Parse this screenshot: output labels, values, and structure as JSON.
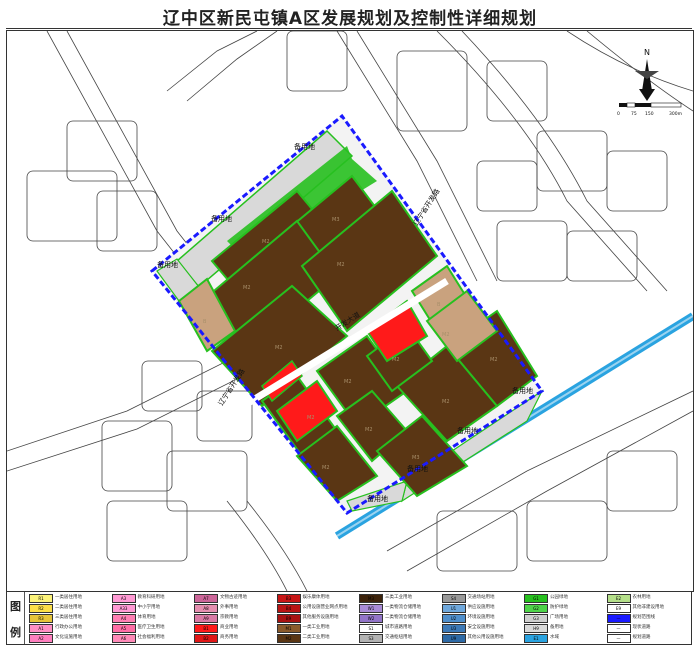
{
  "title": "辽中区新民屯镇A区发展规划及控制性详细规划",
  "legend_heading": [
    "图",
    "例"
  ],
  "map": {
    "reserve_label": "备用地",
    "road_main": "开发大道",
    "road_ne": "辽宁省开发路",
    "road_sw": "辽宁省开发路",
    "block_codes": [
      "M2",
      "M3",
      "M2",
      "M2",
      "M2",
      "M2",
      "B",
      "B",
      "M2",
      "M2",
      "M2",
      "M3",
      "M2",
      "M2",
      "M2",
      "M2"
    ],
    "scale_labels": [
      "0",
      "75",
      "150",
      "300m"
    ],
    "north_label": "N",
    "colors": {
      "industrial": "#5a3614",
      "commercial_red": "#ff1a1a",
      "residential_tan": "#c9a27e",
      "reserve_grey": "#d9d9d9",
      "green": "#27c01f",
      "boundary_blue": "#1a1aff",
      "river": "#2aa3e0",
      "road_line": "#444444"
    }
  },
  "legend": [
    {
      "code": "R1",
      "label": "一类居住用地",
      "color": "#fcf37a"
    },
    {
      "code": "R2",
      "label": "二类居住用地",
      "color": "#fcdf48"
    },
    {
      "code": "R3",
      "label": "三类居住用地",
      "color": "#e6c53a"
    },
    {
      "code": "A1",
      "label": "行政办公用地",
      "color": "#ff8fc4"
    },
    {
      "code": "A2",
      "label": "文化设施用地",
      "color": "#ff7fbf"
    },
    {
      "code": "A3",
      "label": "教育科研用地",
      "color": "#ff9ad4"
    },
    {
      "code": "A33",
      "label": "中小学用地",
      "color": "#ff9ad4"
    },
    {
      "code": "A4",
      "label": "体育用地",
      "color": "#ff80b4"
    },
    {
      "code": "A5",
      "label": "医疗卫生用地",
      "color": "#ff6ea6"
    },
    {
      "code": "A6",
      "label": "社会福利用地",
      "color": "#ff8ab8"
    },
    {
      "code": "A7",
      "label": "文物古迹用地",
      "color": "#cc6699"
    },
    {
      "code": "A8",
      "label": "外事用地",
      "color": "#e58fb0"
    },
    {
      "code": "A9",
      "label": "宗教用地",
      "color": "#d97aa5"
    },
    {
      "code": "B1",
      "label": "商业用地",
      "color": "#ff1a1a"
    },
    {
      "code": "B2",
      "label": "商务用地",
      "color": "#e01717"
    },
    {
      "code": "B3",
      "label": "娱乐康体用地",
      "color": "#c81616"
    },
    {
      "code": "B4",
      "label": "公用设施营业网点用地",
      "color": "#b91414"
    },
    {
      "code": "B9",
      "label": "其他服务设施用地",
      "color": "#a81212"
    },
    {
      "code": "M1",
      "label": "一类工业用地",
      "color": "#8a5a2b"
    },
    {
      "code": "M2",
      "label": "二类工业用地",
      "color": "#5a3614"
    },
    {
      "code": "M3",
      "label": "三类工业用地",
      "color": "#3d230b"
    },
    {
      "code": "W1",
      "label": "一类物流仓储用地",
      "color": "#a98bd6"
    },
    {
      "code": "W2",
      "label": "二类物流仓储用地",
      "color": "#9375c9"
    },
    {
      "code": "S1",
      "label": "城市道路用地",
      "color": "#ffffff"
    },
    {
      "code": "S3",
      "label": "交通枢纽用地",
      "color": "#b3b3b3"
    },
    {
      "code": "S4",
      "label": "交通场站用地",
      "color": "#999999"
    },
    {
      "code": "U1",
      "label": "供应设施用地",
      "color": "#6fa8dc"
    },
    {
      "code": "U2",
      "label": "环境设施用地",
      "color": "#4f8fcc"
    },
    {
      "code": "U3",
      "label": "安全设施用地",
      "color": "#3d7ab8"
    },
    {
      "code": "U9",
      "label": "其他公用设施用地",
      "color": "#2e6aa6"
    },
    {
      "code": "G1",
      "label": "公园绿地",
      "color": "#27c01f"
    },
    {
      "code": "G2",
      "label": "防护绿地",
      "color": "#4fd44a"
    },
    {
      "code": "G3",
      "label": "广场用地",
      "color": "#cfcfcf"
    },
    {
      "code": "H9",
      "label": "备用地",
      "color": "#d9d9d9"
    },
    {
      "code": "E1",
      "label": "水域",
      "color": "#2aa3e0"
    },
    {
      "code": "E2",
      "label": "农林用地",
      "color": "#b5e08a"
    },
    {
      "code": "E9",
      "label": "其他非建设用地",
      "color": "#ffffff"
    },
    {
      "code": "—",
      "label": "规划范围线",
      "color": "#1a1aff"
    },
    {
      "code": "—",
      "label": "现状道路",
      "color": "#ffffff"
    },
    {
      "code": "—",
      "label": "规划道路",
      "color": "#ffffff"
    }
  ]
}
